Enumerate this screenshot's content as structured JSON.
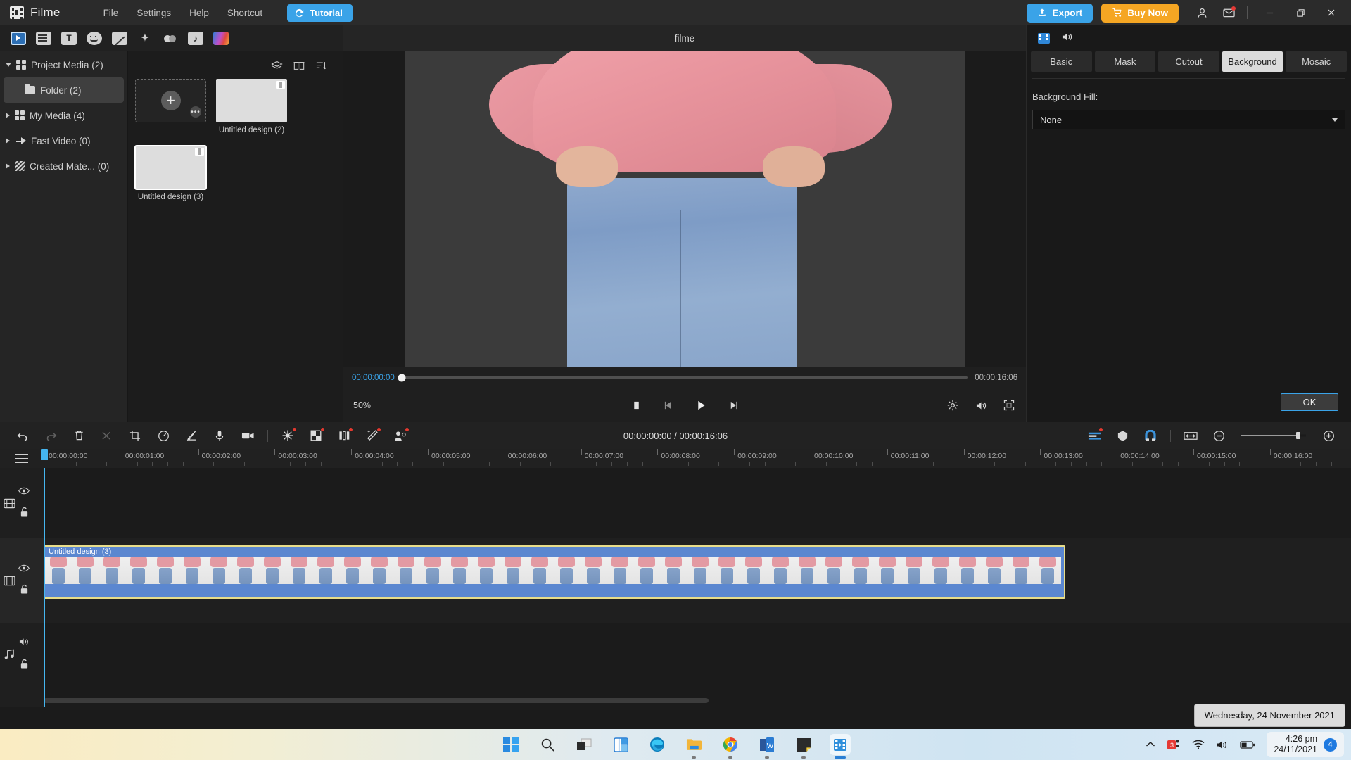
{
  "titlebar": {
    "app_name": "Filme",
    "menus": [
      "File",
      "Settings",
      "Help",
      "Shortcut"
    ],
    "tutorial_label": "Tutorial",
    "export_label": "Export",
    "buy_label": "Buy Now",
    "accent_blue": "#3aa3e8",
    "accent_orange": "#f5a623",
    "icons": {
      "logo": "filme-logo-icon",
      "tutorial": "tutorial-icon",
      "export": "upload-icon",
      "buy": "cart-icon",
      "account": "user-icon",
      "mail": "mail-icon",
      "minimize": "minimize-icon",
      "maximize": "restore-icon",
      "close": "close-icon"
    }
  },
  "toolstrip": {
    "items": [
      {
        "name": "media-library-tab",
        "active": true
      },
      {
        "name": "templates-tab",
        "active": false
      },
      {
        "name": "text-tab",
        "active": false
      },
      {
        "name": "stickers-tab",
        "active": false
      },
      {
        "name": "effects-tab",
        "active": false
      },
      {
        "name": "elements-tab",
        "active": false
      },
      {
        "name": "transitions-tab",
        "active": false
      },
      {
        "name": "audio-tab",
        "active": false
      },
      {
        "name": "filters-tab",
        "active": false
      }
    ]
  },
  "sidebar": {
    "items": [
      {
        "label": "Project Media (2)",
        "icon": "grid-icon",
        "expanded": true,
        "selected": false,
        "sub": false
      },
      {
        "label": "Folder (2)",
        "icon": "folder-icon",
        "expanded": false,
        "selected": true,
        "sub": true
      },
      {
        "label": "My Media (4)",
        "icon": "grid-icon",
        "expanded": false,
        "selected": false,
        "sub": false
      },
      {
        "label": "Fast Video (0)",
        "icon": "fast-video-icon",
        "expanded": false,
        "selected": false,
        "sub": false
      },
      {
        "label": "Created Mate... (0)",
        "icon": "created-material-icon",
        "expanded": false,
        "selected": false,
        "sub": false
      }
    ]
  },
  "media_panel": {
    "tools": [
      "layers-icon",
      "grid-view-icon",
      "sort-icon"
    ],
    "add_tile": {
      "plus": "+",
      "more": "•••"
    },
    "items": [
      {
        "label": "Untitled design (2)",
        "kind": "ph-green",
        "selected": false
      },
      {
        "label": "Untitled design (3)",
        "kind": "ph-pink",
        "selected": true
      }
    ]
  },
  "preview": {
    "title": "filme",
    "current_time": "00:00:00:00",
    "total_time": "00:00:16:06",
    "zoom_level": "50%",
    "controls": [
      "stop-button",
      "previous-frame-button",
      "play-button",
      "next-frame-button"
    ],
    "right_controls": [
      "settings-icon",
      "volume-icon",
      "fullscreen-icon"
    ]
  },
  "right_panel": {
    "head_icons": [
      "video-properties-icon",
      "audio-properties-icon"
    ],
    "tabs": [
      {
        "label": "Basic",
        "active": false
      },
      {
        "label": "Mask",
        "active": false
      },
      {
        "label": "Cutout",
        "active": false
      },
      {
        "label": "Background",
        "active": true
      },
      {
        "label": "Mosaic",
        "active": false
      }
    ],
    "background_fill_label": "Background Fill:",
    "background_fill_value": "None",
    "ok_label": "OK"
  },
  "timeline_toolbar": {
    "left_tools": [
      {
        "name": "undo-button",
        "dim": false,
        "badge": false
      },
      {
        "name": "redo-button",
        "dim": true,
        "badge": false
      },
      {
        "name": "delete-button",
        "dim": false,
        "badge": false
      },
      {
        "name": "split-button",
        "dim": true,
        "badge": false
      },
      {
        "name": "crop-button",
        "dim": false,
        "badge": false
      },
      {
        "name": "speed-button",
        "dim": false,
        "badge": false
      },
      {
        "name": "color-edit-button",
        "dim": false,
        "badge": false
      },
      {
        "name": "voiceover-button",
        "dim": false,
        "badge": false
      },
      {
        "name": "record-screen-button",
        "dim": false,
        "badge": false
      }
    ],
    "badged_tools": [
      {
        "name": "ai-effects-button",
        "badge": true
      },
      {
        "name": "green-screen-button",
        "badge": true
      },
      {
        "name": "color-match-button",
        "badge": true
      },
      {
        "name": "auto-enhance-button",
        "badge": true
      },
      {
        "name": "face-off-button",
        "badge": true
      }
    ],
    "timecode": "00:00:00:00 / 00:00:16:06",
    "right_tools": [
      {
        "name": "marker-button",
        "badge": true
      },
      {
        "name": "mask-shape-button",
        "badge": false
      },
      {
        "name": "magnet-snap-button",
        "badge": false
      },
      {
        "name": "fit-timeline-button",
        "badge": false
      }
    ],
    "zoom_out_icon": "zoom-out-icon",
    "zoom_in_icon": "zoom-in-icon"
  },
  "timeline": {
    "menu_icon": "timeline-menu-icon",
    "ruler_labels": [
      "00:00:00:00",
      "00:00:01:00",
      "00:00:02:00",
      "00:00:03:00",
      "00:00:04:00",
      "00:00:05:00",
      "00:00:06:00",
      "00:00:07:00",
      "00:00:08:00",
      "00:00:09:00",
      "00:00:10:00",
      "00:00:11:00",
      "00:00:12:00",
      "00:00:13:00",
      "00:00:14:00",
      "00:00:15:00",
      "00:00:16:00"
    ],
    "playhead_time": "00:00:00:00",
    "tracks": [
      {
        "name": "video-track-1",
        "icon": "film-icon",
        "toggles": [
          "eye-icon",
          "lock-icon"
        ]
      },
      {
        "name": "video-track-2",
        "icon": "film-icon",
        "toggles": [
          "eye-icon",
          "lock-icon"
        ]
      },
      {
        "name": "audio-track-1",
        "icon": "music-icon",
        "toggles": [
          "speaker-icon",
          "lock-icon"
        ]
      }
    ],
    "clip": {
      "label": "Untitled design (3)",
      "selected": true,
      "frame_count": 38
    }
  },
  "tooltip": {
    "text": "Wednesday, 24 November 2021"
  },
  "taskbar": {
    "apps": [
      {
        "name": "start-button",
        "running": false
      },
      {
        "name": "search-button",
        "running": false
      },
      {
        "name": "task-view-button",
        "running": false
      },
      {
        "name": "widgets-button",
        "running": false
      },
      {
        "name": "microsoft-edge-icon",
        "running": false
      },
      {
        "name": "file-explorer-icon",
        "running": true
      },
      {
        "name": "google-chrome-icon",
        "running": true
      },
      {
        "name": "microsoft-word-icon",
        "running": true
      },
      {
        "name": "sticky-notes-icon",
        "running": true
      },
      {
        "name": "filme-app-icon",
        "running": true,
        "active": true
      }
    ],
    "tray": {
      "chevron": "show-hidden-icons",
      "icons": [
        "teams-icon",
        "wifi-icon",
        "volume-icon",
        "battery-icon"
      ],
      "time": "4:26 pm",
      "date": "24/11/2021",
      "notification_count": "4"
    }
  }
}
